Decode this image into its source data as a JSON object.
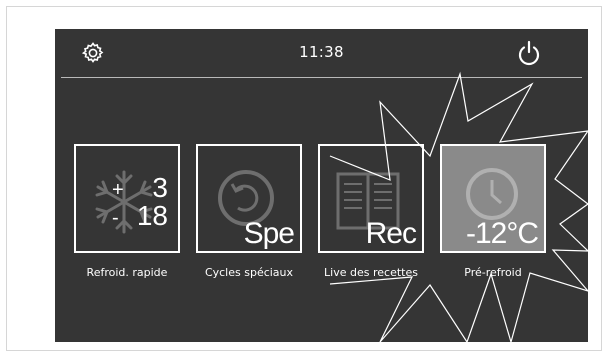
{
  "header": {
    "time": "11:38",
    "settings_icon": "gear-icon",
    "power_icon": "power-icon"
  },
  "tiles": [
    {
      "icon": "snowflake-icon",
      "top_value": "3",
      "top_sign": "+",
      "bottom_value": "18",
      "bottom_sign": "-",
      "caption": "Refroid. rapide"
    },
    {
      "icon": "cycle-icon",
      "label": "Spe",
      "caption": "Cycles spéciaux"
    },
    {
      "icon": "book-icon",
      "label": "Rec",
      "caption": "Live des recettes"
    },
    {
      "icon": "clock-icon",
      "label": "-12°C",
      "caption": "Pré-refroid",
      "active": true
    }
  ],
  "colors": {
    "screen_bg": "#353535",
    "active_tile_bg": "#8a8a8a",
    "foreground": "#ffffff"
  }
}
